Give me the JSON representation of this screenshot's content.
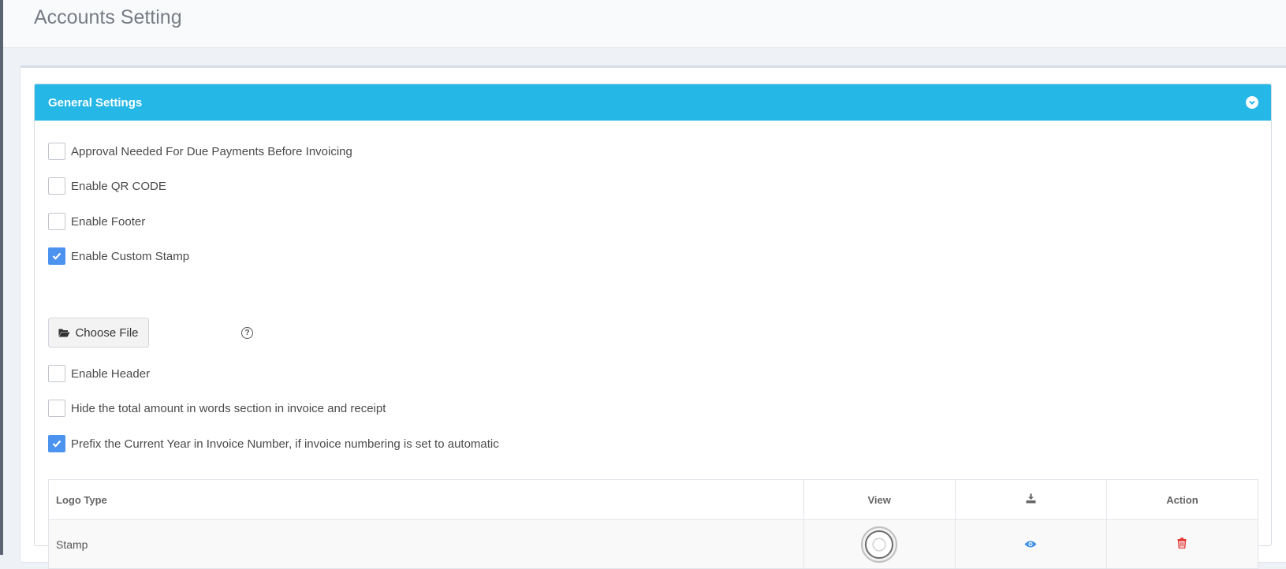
{
  "page": {
    "title": "Accounts Setting"
  },
  "panel": {
    "title": "General Settings",
    "collapse_icon": "chevron-down-circle-icon"
  },
  "settings": [
    {
      "label": "Approval Needed For Due Payments Before Invoicing",
      "checked": false
    },
    {
      "label": "Enable QR CODE",
      "checked": false
    },
    {
      "label": "Enable Footer",
      "checked": false
    },
    {
      "label": "Enable Custom Stamp",
      "checked": true
    },
    {
      "label": "Enable Header",
      "checked": false
    },
    {
      "label": "Hide the total amount in words section in invoice and receipt",
      "checked": false
    },
    {
      "label": "Prefix the Current Year in Invoice Number, if invoice numbering is set to automatic",
      "checked": true
    }
  ],
  "file_upload": {
    "button_label": "Choose File",
    "icon": "folder-open-icon",
    "help_icon": "question-circle-icon"
  },
  "logo_table": {
    "headers": {
      "logo_type": "Logo Type",
      "view": "View",
      "download_icon": "download-icon",
      "action": "Action"
    },
    "rows": [
      {
        "logo_type": "Stamp",
        "view_icon": "eye-icon",
        "action_icon": "trash-icon"
      }
    ]
  },
  "colors": {
    "accent": "#25b7e6",
    "checkbox_checked": "#4b93ee",
    "delete_red": "#e53935",
    "view_blue": "#3a8ee6"
  }
}
